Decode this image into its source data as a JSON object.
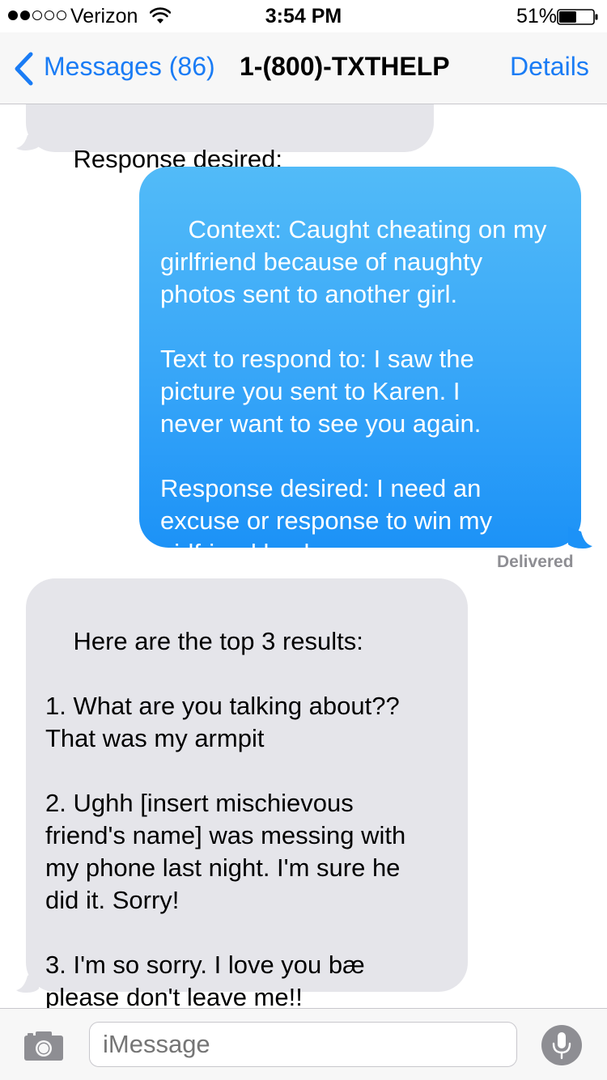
{
  "status_bar": {
    "carrier": "Verizon",
    "time": "3:54 PM",
    "battery": "51%",
    "signal_bars_filled": 2,
    "signal_bars_total": 5,
    "battery_level": 0.51
  },
  "nav": {
    "back_label": "Messages (86)",
    "title": "1-(800)-TXTHELP",
    "details_label": "Details"
  },
  "messages": [
    {
      "direction": "incoming",
      "text": "Response desired:"
    },
    {
      "direction": "outgoing",
      "text": "Context: Caught cheating on my\ngirlfriend because of naughty\nphotos sent to another girl.\n\nText to respond to: I saw the\npicture you sent to Karen. I\nnever want to see you again.\n\nResponse desired: I need an\nexcuse or response to win my\ngirlfriend back."
    },
    {
      "direction": "incoming",
      "text": "Here are the top 3 results:\n\n1. What are you talking about??\nThat was my armpit\n\n2. Ughh [insert mischievous\nfriend's name] was messing with\nmy phone last night. I'm sure he\ndid it. Sorry!\n\n3. I'm so sorry. I love you bæ\nplease don't leave me!!"
    }
  ],
  "delivered_label": "Delivered",
  "input": {
    "placeholder": "iMessage"
  },
  "colors": {
    "accent": "#1a7cf5",
    "incoming_bubble": "#e5e5ea",
    "outgoing_bubble": "#2f9ff8"
  },
  "icons": {
    "back": "chevron-left-icon",
    "camera": "camera-icon",
    "mic": "microphone-icon",
    "wifi": "wifi-icon",
    "battery": "battery-icon"
  }
}
